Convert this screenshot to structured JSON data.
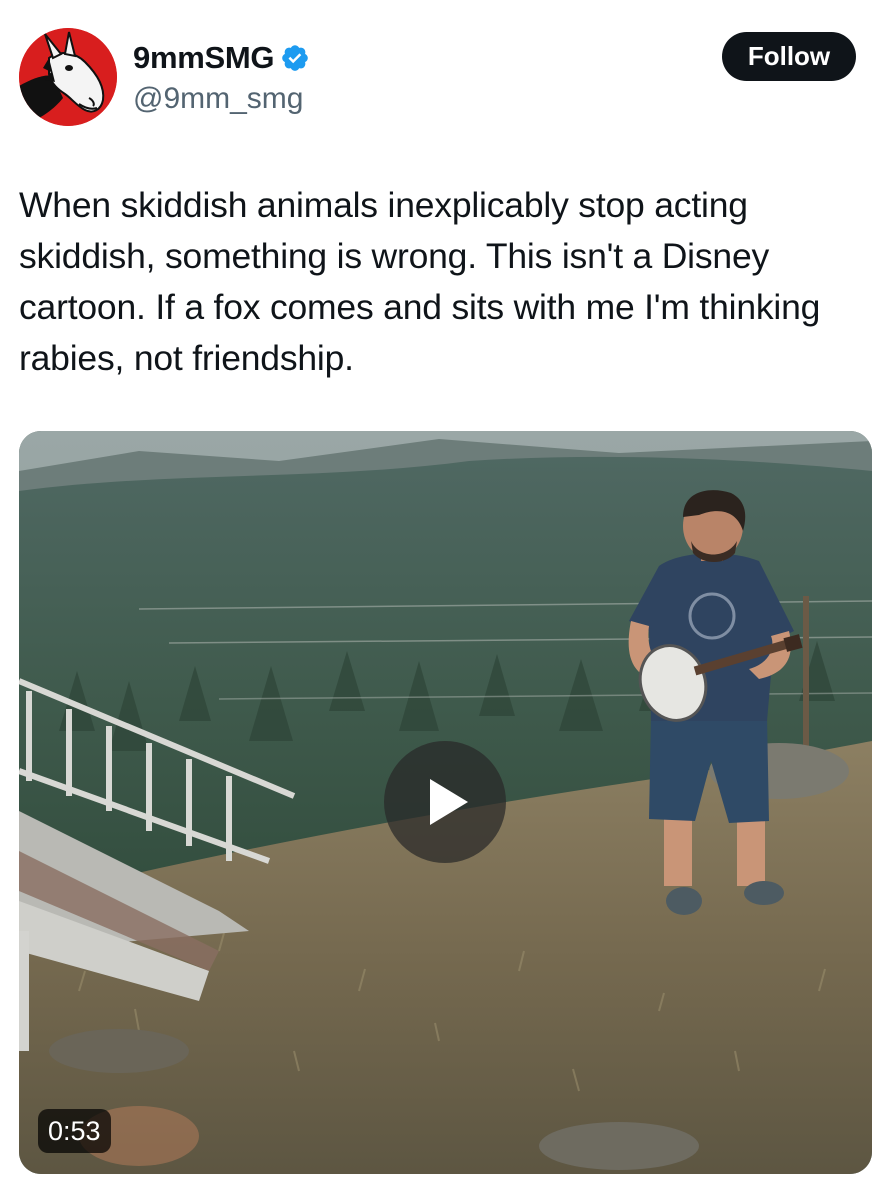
{
  "author": {
    "display_name": "9mmSMG",
    "handle": "@9mm_smg",
    "verified": true,
    "avatar_icon": "donkey-mascot-icon",
    "avatar_color": "#d81e1e"
  },
  "follow_button": {
    "label": "Follow"
  },
  "tweet": {
    "text": "When skiddish animals inexplicably stop acting skiddish, something is wrong. This isn't a Disney cartoon. If a fox comes and sits with me I'm thinking rabies, not friendship."
  },
  "media": {
    "type": "video",
    "duration": "0:53",
    "play_icon": "play-icon"
  },
  "colors": {
    "text_primary": "#0f1419",
    "text_secondary": "#536471",
    "verified_blue": "#1d9bf0",
    "button_bg": "#0f1419",
    "button_text": "#ffffff"
  }
}
